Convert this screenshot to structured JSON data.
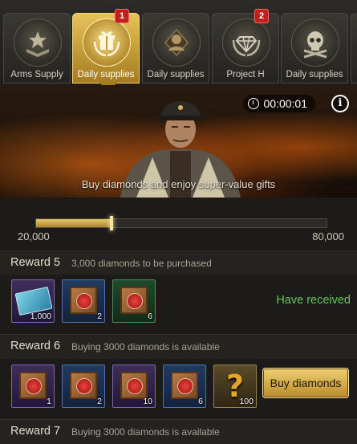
{
  "tabs": [
    {
      "label": "Arms Supply",
      "icon": "military-star-icon",
      "badge": ""
    },
    {
      "label": "Daily supplies",
      "icon": "gift-laurel-icon",
      "badge": "1",
      "active": true
    },
    {
      "label": "Daily supplies",
      "icon": "soldier-silhouette-icon",
      "badge": ""
    },
    {
      "label": "Project H",
      "icon": "diamond-laurel-icon",
      "badge": "2"
    },
    {
      "label": "Daily supplies",
      "icon": "skull-crossbones-icon",
      "badge": ""
    }
  ],
  "banner": {
    "timer": "00:00:01",
    "info_label": "i",
    "caption": "Buy diamonds and enjoy super-value gifts"
  },
  "progress": {
    "min_label": "20,000",
    "max_label": "80,000",
    "fraction": 0.26
  },
  "rewards": [
    {
      "title": "Reward 5",
      "subtitle": "3,000 diamonds to be purchased",
      "status": "Have received",
      "items": [
        {
          "icon": "blue-ticket-icon",
          "rarity": "purple",
          "qty": "1,000"
        },
        {
          "icon": "supply-crate-icon",
          "rarity": "blue",
          "qty": "2"
        },
        {
          "icon": "supply-crate-icon",
          "rarity": "green",
          "qty": "6"
        }
      ]
    },
    {
      "title": "Reward 6",
      "subtitle": "Buying 3000 diamonds is available",
      "button": "Buy diamonds",
      "items": [
        {
          "icon": "supply-crate-icon",
          "rarity": "purple",
          "qty": "1"
        },
        {
          "icon": "supply-crate-icon",
          "rarity": "blue",
          "qty": "2"
        },
        {
          "icon": "supply-crate-icon",
          "rarity": "purple",
          "qty": "10"
        },
        {
          "icon": "supply-crate-icon",
          "rarity": "blue",
          "qty": "6"
        },
        {
          "icon": "question-mark-icon",
          "rarity": "gold",
          "qty": "100"
        }
      ]
    },
    {
      "title": "Reward 7",
      "subtitle": "Buying 3000 diamonds is available"
    }
  ]
}
